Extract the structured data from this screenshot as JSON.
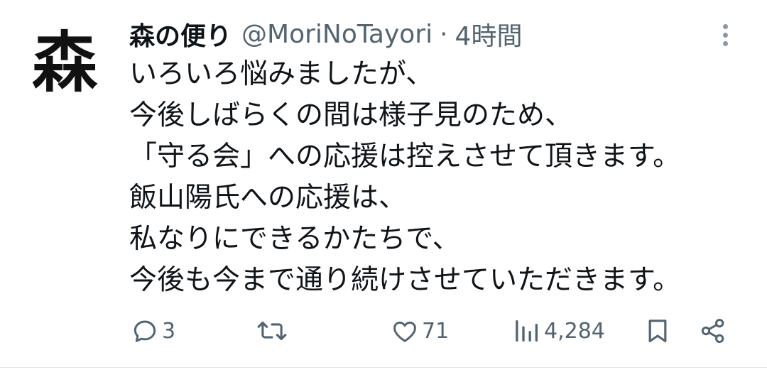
{
  "tweet": {
    "avatar_text": "森",
    "display_name": "森の便り",
    "handle": "@MoriNoTayori",
    "separator": "·",
    "time": "4時間",
    "lines": [
      "いろいろ悩みましたが、",
      "今後しばらくの間は様子見のため、",
      "「守る会」への応援は控えさせて頂きます。",
      "飯山陽氏への応援は、",
      "私なりにできるかたちで、",
      "今後も今まで通り続けさせていただきます。"
    ]
  },
  "actions": {
    "reply_count": "3",
    "retweet_count": "",
    "like_count": "71",
    "views_count": "4,284"
  },
  "icons": {
    "more": "more-vertical-icon",
    "reply": "reply-bubble-icon",
    "retweet": "retweet-icon",
    "like": "heart-icon",
    "views": "views-bar-chart-icon",
    "bookmark": "bookmark-icon",
    "share": "share-icon"
  },
  "colors": {
    "text": "#0f1419",
    "secondary": "#536471",
    "divider": "#e6e6e6"
  }
}
